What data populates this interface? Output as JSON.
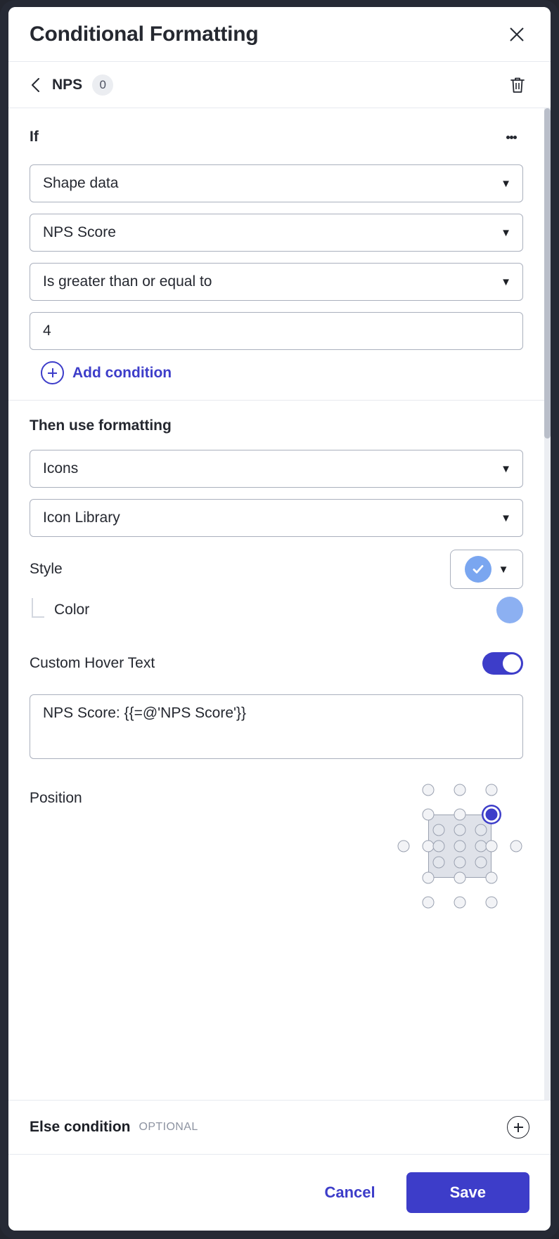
{
  "window": {
    "title": "Conditional Formatting",
    "close_icon": "close-icon"
  },
  "breadcrumb": {
    "back_icon": "chevron-left-icon",
    "name": "NPS",
    "badge": "0",
    "delete_icon": "trash-icon"
  },
  "if_section": {
    "title": "If",
    "menu_icon": "kebab-menu-icon",
    "fields": [
      {
        "name": "source-type-select",
        "value": "Shape data",
        "caret": "▼"
      },
      {
        "name": "data-field-select",
        "value": "NPS Score",
        "caret": "▼"
      },
      {
        "name": "operator-select",
        "value": "Is greater than or equal to",
        "caret": "▼"
      }
    ],
    "value_input": {
      "value": "4",
      "placeholder": "Value"
    },
    "add_condition_label": "Add condition"
  },
  "then_section": {
    "title": "Then use formatting",
    "format_type_select": {
      "value": "Icons",
      "caret": "▼"
    },
    "icon_set_select": {
      "value": "Icon Library",
      "caret": "▼"
    },
    "style": {
      "label": "Style",
      "icon": "check-circle-icon",
      "caret": "▼"
    },
    "color": {
      "label": "Color",
      "swatch_hex": "#8CB0F2"
    },
    "hover_text": {
      "label": "Custom Hover Text",
      "enabled": true,
      "value": "NPS Score: {{=@'NPS Score'}}",
      "placeholder": "Enter hover text"
    },
    "position": {
      "label": "Position",
      "selected": "top-right",
      "rows": 5,
      "cols": 5
    }
  },
  "else_section": {
    "title": "Else condition",
    "optional_label": "OPTIONAL",
    "add_icon": "plus-circle-icon"
  },
  "footer": {
    "cancel_label": "Cancel",
    "save_label": "Save"
  },
  "theme": {
    "accent": "#3D3DC9",
    "icon_blue": "#7AA6F0",
    "frame": "#262A35"
  }
}
